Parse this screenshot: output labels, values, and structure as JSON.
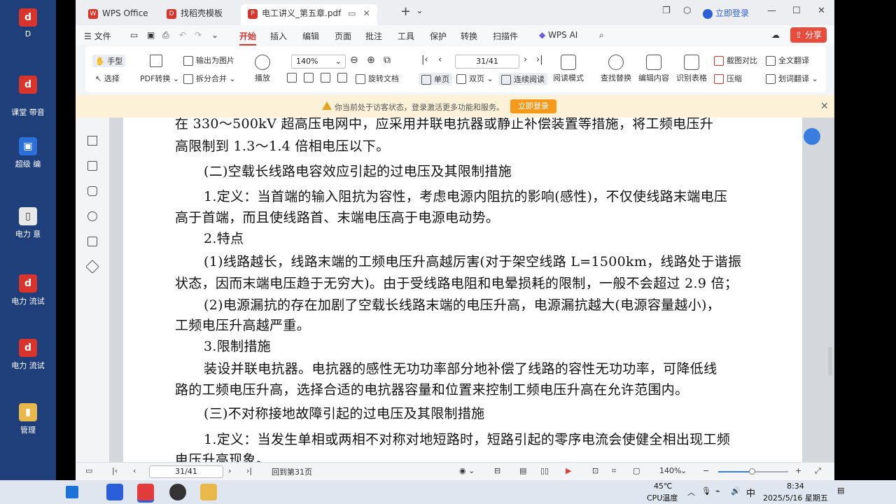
{
  "desktop": {
    "icons": [
      {
        "label": "D",
        "glyph": "d"
      },
      {
        "label": "",
        "glyph": "d"
      },
      {
        "label": "课堂 带音",
        "glyph": "d"
      },
      {
        "label": "超级 编",
        "glyph": "▣"
      },
      {
        "label": "电力 意",
        "glyph": "▯"
      },
      {
        "label": "电力 流试",
        "glyph": "d"
      },
      {
        "label": "电力 流试",
        "glyph": "d"
      },
      {
        "label": "管理",
        "glyph": "▮"
      }
    ]
  },
  "titlebar": {
    "tabs": [
      {
        "label": "WPS Office",
        "icon": "wps-logo-icon"
      },
      {
        "label": "找稻壳模板",
        "icon": "docer-icon"
      },
      {
        "label": "电工讲义_第五章.pdf",
        "icon": "pdf-icon"
      }
    ],
    "new_tab": "+",
    "login": "立即登录"
  },
  "menubar": {
    "file": "文件",
    "items": [
      "开始",
      "插入",
      "编辑",
      "页面",
      "批注",
      "工具",
      "保护",
      "转换",
      "扫描件",
      "WPS AI"
    ],
    "active": "开始",
    "share": "分享"
  },
  "toolbar": {
    "hand": "手型",
    "select": "选择",
    "pdf_convert": "PDF转换",
    "export_image": "输出为图片",
    "split_merge": "拆分合并",
    "play": "播放",
    "zoom": "140%",
    "page": "31/41",
    "rotate": "旋转文档",
    "single": "单页",
    "double": "双页",
    "continuous": "连续阅读",
    "read_mode": "阅读模式",
    "find_replace": "查找替换",
    "edit_content": "编辑内容",
    "recognize_table": "识别表格",
    "screenshot_compare": "截图对比",
    "compress": "压缩",
    "full_translate": "全文翻译",
    "word_translate": "划词翻译"
  },
  "notice": {
    "text": "你当前处于访客状态，登录激活更多功能和服务。",
    "button": "立即登录"
  },
  "document": {
    "lines": [
      "在 330～500kV 超高压电网中，应采用并联电抗器或静止补偿装置等措施，将工频电压升",
      "高限制到 1.3～1.4 倍相电压以下。",
      "(二)空载长线路电容效应引起的过电压及其限制措施",
      "1.定义：当首端的输入阻抗为容性，考虑电源内阻抗的影响(感性)，不仅使线路末端电压",
      "高于首端，而且使线路首、末端电压高于电源电动势。",
      "2.特点",
      "(1)线路越长，线路末端的工频电压升高越厉害(对于架空线路 L=1500km，线路处于谐振",
      "状态，因而末端电压趋于无穷大)。由于受线路电阻和电晕损耗的限制，一般不会超过 2.9 倍；",
      "(2)电源漏抗的存在加剧了空载长线路末端的电压升高，电源漏抗越大(电源容量越小)，",
      "工频电压升高越严重。",
      "3.限制措施",
      "装设并联电抗器。电抗器的感性无功功率部分地补偿了线路的容性无功功率，可降低线",
      "路的工频电压升高，选择合适的电抗器容量和位置来控制工频电压升高在允许范围内。",
      "(三)不对称接地故障引起的过电压及其限制措施",
      "1.定义：当发生单相或两相不对称对地短路时，短路引起的零序电流会使健全相出现工频",
      "电压升高现象。"
    ]
  },
  "statusbar": {
    "page": "31/41",
    "back_to": "回到第31页",
    "zoom": "140%",
    "zoom_level": 0.48
  },
  "taskbar": {
    "temp": "45℃",
    "temp_label": "CPU温度",
    "ime": "中",
    "time": "8:34",
    "date": "2025/5/16 星期五"
  }
}
